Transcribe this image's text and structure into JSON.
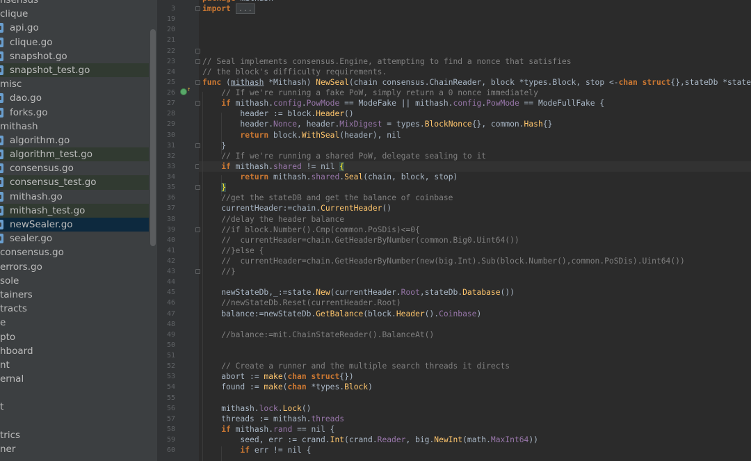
{
  "sidebar": {
    "items": [
      {
        "label": "nsensus",
        "indent": 0,
        "icon": false,
        "state": ""
      },
      {
        "label": "clique",
        "indent": 0,
        "icon": false,
        "state": ""
      },
      {
        "label": "api.go",
        "indent": 1,
        "icon": true,
        "state": ""
      },
      {
        "label": "clique.go",
        "indent": 1,
        "icon": true,
        "state": ""
      },
      {
        "label": "snapshot.go",
        "indent": 1,
        "icon": true,
        "state": ""
      },
      {
        "label": "snapshot_test.go",
        "indent": 1,
        "icon": true,
        "state": "tested"
      },
      {
        "label": "misc",
        "indent": 0,
        "icon": false,
        "state": ""
      },
      {
        "label": "dao.go",
        "indent": 1,
        "icon": true,
        "state": ""
      },
      {
        "label": "forks.go",
        "indent": 1,
        "icon": true,
        "state": ""
      },
      {
        "label": "mithash",
        "indent": 0,
        "icon": false,
        "state": ""
      },
      {
        "label": "algorithm.go",
        "indent": 1,
        "icon": true,
        "state": ""
      },
      {
        "label": "algorithm_test.go",
        "indent": 1,
        "icon": true,
        "state": "tested"
      },
      {
        "label": "consensus.go",
        "indent": 1,
        "icon": true,
        "state": ""
      },
      {
        "label": "consensus_test.go",
        "indent": 1,
        "icon": true,
        "state": "tested"
      },
      {
        "label": "mithash.go",
        "indent": 1,
        "icon": true,
        "state": ""
      },
      {
        "label": "mithash_test.go",
        "indent": 1,
        "icon": true,
        "state": "tested"
      },
      {
        "label": "newSealer.go",
        "indent": 1,
        "icon": true,
        "state": "selected"
      },
      {
        "label": "sealer.go",
        "indent": 1,
        "icon": true,
        "state": ""
      },
      {
        "label": "consensus.go",
        "indent": 0,
        "icon": false,
        "state": ""
      },
      {
        "label": "errors.go",
        "indent": 0,
        "icon": false,
        "state": ""
      },
      {
        "label": "sole",
        "indent": 0,
        "icon": false,
        "state": ""
      },
      {
        "label": "tainers",
        "indent": 0,
        "icon": false,
        "state": ""
      },
      {
        "label": "tracts",
        "indent": 0,
        "icon": false,
        "state": ""
      },
      {
        "label": "e",
        "indent": 0,
        "icon": false,
        "state": ""
      },
      {
        "label": "pto",
        "indent": 0,
        "icon": false,
        "state": ""
      },
      {
        "label": "hboard",
        "indent": 0,
        "icon": false,
        "state": ""
      },
      {
        "label": "nt",
        "indent": 0,
        "icon": false,
        "state": ""
      },
      {
        "label": "ernal",
        "indent": 0,
        "icon": false,
        "state": ""
      },
      {
        "label": "",
        "indent": 0,
        "icon": false,
        "state": ""
      },
      {
        "label": "t",
        "indent": 0,
        "icon": false,
        "state": ""
      },
      {
        "label": "",
        "indent": 0,
        "icon": false,
        "state": ""
      },
      {
        "label": "trics",
        "indent": 0,
        "icon": false,
        "state": ""
      },
      {
        "label": "ner",
        "indent": 0,
        "icon": false,
        "state": ""
      }
    ]
  },
  "editor": {
    "current_line": 33,
    "lines": [
      {
        "n": "",
        "t": [
          [
            "kw",
            "package"
          ],
          [
            "tp",
            " mithash"
          ]
        ]
      },
      {
        "n": "3",
        "t": [
          [
            "kw",
            "import"
          ],
          [
            "tp",
            " "
          ],
          [
            "fold-box",
            "..."
          ]
        ]
      },
      {
        "n": "19",
        "t": []
      },
      {
        "n": "20",
        "t": []
      },
      {
        "n": "21",
        "t": []
      },
      {
        "n": "22",
        "t": []
      },
      {
        "n": "23",
        "t": [
          [
            "cm",
            "// Seal implements consensus.Engine, attempting to find a nonce that satisfies"
          ]
        ]
      },
      {
        "n": "24",
        "t": [
          [
            "cm",
            "// the block's difficulty requirements."
          ]
        ]
      },
      {
        "n": "25",
        "t": [
          [
            "kw",
            "func"
          ],
          [
            "tp",
            " ("
          ],
          [
            "ul",
            "mithash"
          ],
          [
            "tp",
            " *Mithash) "
          ],
          [
            "fn",
            "NewSeal"
          ],
          [
            "tp",
            "(chain consensus.ChainReader, block *types.Block, stop <-"
          ],
          [
            "kw",
            "chan struct"
          ],
          [
            "tp",
            "{},stateDb *state.S"
          ]
        ]
      },
      {
        "n": "26",
        "t": [
          [
            "tp",
            "    "
          ],
          [
            "cm",
            "// If we're running a fake PoW, simply return a 0 nonce immediately"
          ]
        ]
      },
      {
        "n": "27",
        "t": [
          [
            "tp",
            "    "
          ],
          [
            "kw",
            "if"
          ],
          [
            "tp",
            " mithash."
          ],
          [
            "fd",
            "config"
          ],
          [
            "tp",
            "."
          ],
          [
            "fd",
            "PowMode"
          ],
          [
            "tp",
            " == ModeFake || mithash."
          ],
          [
            "fd",
            "config"
          ],
          [
            "tp",
            "."
          ],
          [
            "fd",
            "PowMode"
          ],
          [
            "tp",
            " == ModeFullFake {"
          ]
        ]
      },
      {
        "n": "28",
        "t": [
          [
            "tp",
            "        header := block."
          ],
          [
            "fn",
            "Header"
          ],
          [
            "tp",
            "()"
          ]
        ]
      },
      {
        "n": "29",
        "t": [
          [
            "tp",
            "        header."
          ],
          [
            "fd",
            "Nonce"
          ],
          [
            "tp",
            ", header."
          ],
          [
            "fd",
            "MixDigest"
          ],
          [
            "tp",
            " = types."
          ],
          [
            "fn",
            "BlockNonce"
          ],
          [
            "tp",
            "{}, common."
          ],
          [
            "fn",
            "Hash"
          ],
          [
            "tp",
            "{}"
          ]
        ]
      },
      {
        "n": "30",
        "t": [
          [
            "tp",
            "        "
          ],
          [
            "kw",
            "return"
          ],
          [
            "tp",
            " block."
          ],
          [
            "fn",
            "WithSeal"
          ],
          [
            "tp",
            "(header), nil"
          ]
        ]
      },
      {
        "n": "31",
        "t": [
          [
            "tp",
            "    }"
          ]
        ]
      },
      {
        "n": "32",
        "t": [
          [
            "tp",
            "    "
          ],
          [
            "cm",
            "// If we're running a shared PoW, delegate sealing to it"
          ]
        ]
      },
      {
        "n": "33",
        "t": [
          [
            "tp",
            "    "
          ],
          [
            "kw",
            "if"
          ],
          [
            "tp",
            " mithash."
          ],
          [
            "fd",
            "shared"
          ],
          [
            "tp",
            " != nil "
          ],
          [
            "hl-brace",
            "{"
          ]
        ]
      },
      {
        "n": "34",
        "t": [
          [
            "tp",
            "        "
          ],
          [
            "kw",
            "return"
          ],
          [
            "tp",
            " mithash."
          ],
          [
            "fd",
            "shared"
          ],
          [
            "tp",
            "."
          ],
          [
            "fn",
            "Seal"
          ],
          [
            "tp",
            "(chain, block, stop)"
          ]
        ]
      },
      {
        "n": "35",
        "t": [
          [
            "tp",
            "    "
          ],
          [
            "hl-brace",
            "}"
          ]
        ]
      },
      {
        "n": "36",
        "t": [
          [
            "tp",
            "    "
          ],
          [
            "cm",
            "//get the stateDB and get the balance of coinbase"
          ]
        ]
      },
      {
        "n": "37",
        "t": [
          [
            "tp",
            "    currentHeader:=chain."
          ],
          [
            "fn",
            "CurrentHeader"
          ],
          [
            "tp",
            "()"
          ]
        ]
      },
      {
        "n": "38",
        "t": [
          [
            "tp",
            "    "
          ],
          [
            "cm",
            "//delay the header balance"
          ]
        ]
      },
      {
        "n": "39",
        "t": [
          [
            "tp",
            "    "
          ],
          [
            "cm",
            "//if block.Number().Cmp(common.PoSDis)<=0{"
          ]
        ]
      },
      {
        "n": "40",
        "t": [
          [
            "tp",
            "    "
          ],
          [
            "cm",
            "//  currentHeader=chain.GetHeaderByNumber(common.Big0.Uint64())"
          ]
        ]
      },
      {
        "n": "41",
        "t": [
          [
            "tp",
            "    "
          ],
          [
            "cm",
            "//}else {"
          ]
        ]
      },
      {
        "n": "42",
        "t": [
          [
            "tp",
            "    "
          ],
          [
            "cm",
            "//  currentHeader=chain.GetHeaderByNumber(new(big.Int).Sub(block.Number(),common.PoSDis).Uint64())"
          ]
        ]
      },
      {
        "n": "43",
        "t": [
          [
            "tp",
            "    "
          ],
          [
            "cm",
            "//}"
          ]
        ]
      },
      {
        "n": "44",
        "t": []
      },
      {
        "n": "45",
        "t": [
          [
            "tp",
            "    newStateDb,_:=state."
          ],
          [
            "fn",
            "New"
          ],
          [
            "tp",
            "(currentHeader."
          ],
          [
            "fd",
            "Root"
          ],
          [
            "tp",
            ",stateDb."
          ],
          [
            "fn",
            "Database"
          ],
          [
            "tp",
            "())"
          ]
        ]
      },
      {
        "n": "46",
        "t": [
          [
            "tp",
            "    "
          ],
          [
            "cm",
            "//newStateDb.Reset(currentHeader.Root)"
          ]
        ]
      },
      {
        "n": "47",
        "t": [
          [
            "tp",
            "    balance:=newStateDb."
          ],
          [
            "fn",
            "GetBalance"
          ],
          [
            "tp",
            "(block."
          ],
          [
            "fn",
            "Header"
          ],
          [
            "tp",
            "()."
          ],
          [
            "fd",
            "Coinbase"
          ],
          [
            "tp",
            ")"
          ]
        ]
      },
      {
        "n": "48",
        "t": []
      },
      {
        "n": "49",
        "t": [
          [
            "tp",
            "    "
          ],
          [
            "cm",
            "//balance:=mit.ChainStateReader().BalanceAt()"
          ]
        ]
      },
      {
        "n": "50",
        "t": []
      },
      {
        "n": "51",
        "t": []
      },
      {
        "n": "52",
        "t": [
          [
            "tp",
            "    "
          ],
          [
            "cm",
            "// Create a runner and the multiple search threads it directs"
          ]
        ]
      },
      {
        "n": "53",
        "t": [
          [
            "tp",
            "    abort := "
          ],
          [
            "fn",
            "make"
          ],
          [
            "tp",
            "("
          ],
          [
            "kw",
            "chan struct"
          ],
          [
            "tp",
            "{})"
          ]
        ]
      },
      {
        "n": "54",
        "t": [
          [
            "tp",
            "    found := "
          ],
          [
            "fn",
            "make"
          ],
          [
            "tp",
            "("
          ],
          [
            "kw",
            "chan"
          ],
          [
            "tp",
            " *types."
          ],
          [
            "fn",
            "Block"
          ],
          [
            "tp",
            ")"
          ]
        ]
      },
      {
        "n": "55",
        "t": []
      },
      {
        "n": "56",
        "t": [
          [
            "tp",
            "    mithash."
          ],
          [
            "fd",
            "lock"
          ],
          [
            "tp",
            "."
          ],
          [
            "fn",
            "Lock"
          ],
          [
            "tp",
            "()"
          ]
        ]
      },
      {
        "n": "57",
        "t": [
          [
            "tp",
            "    threads := mithash."
          ],
          [
            "fd",
            "threads"
          ]
        ]
      },
      {
        "n": "58",
        "t": [
          [
            "tp",
            "    "
          ],
          [
            "kw",
            "if"
          ],
          [
            "tp",
            " mithash."
          ],
          [
            "fd",
            "rand"
          ],
          [
            "tp",
            " == nil {"
          ]
        ]
      },
      {
        "n": "59",
        "t": [
          [
            "tp",
            "        seed, err := crand."
          ],
          [
            "fn",
            "Int"
          ],
          [
            "tp",
            "(crand."
          ],
          [
            "fd",
            "Reader"
          ],
          [
            "tp",
            ", big."
          ],
          [
            "fn",
            "NewInt"
          ],
          [
            "tp",
            "(math."
          ],
          [
            "fd",
            "MaxInt64"
          ],
          [
            "tp",
            "))"
          ]
        ]
      },
      {
        "n": "60",
        "t": [
          [
            "tp",
            "        "
          ],
          [
            "kw",
            "if"
          ],
          [
            "tp",
            " err != nil {"
          ]
        ]
      }
    ]
  }
}
